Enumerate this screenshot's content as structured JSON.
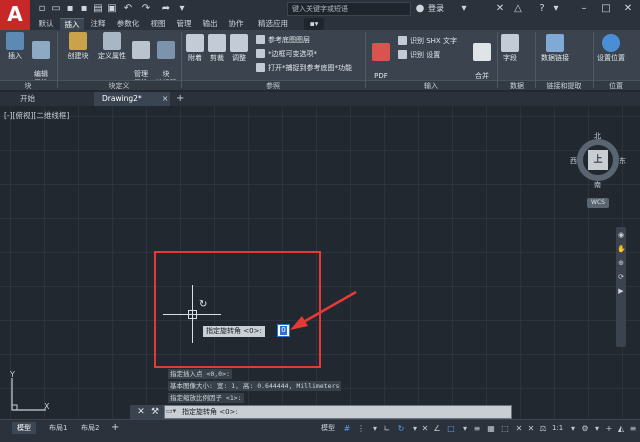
{
  "app": {
    "logo": "A"
  },
  "title_bar": {
    "search_placeholder": "键入关键字或短语",
    "signin_label": "登录"
  },
  "ribbon_tabs": [
    "默认",
    "插入",
    "注释",
    "参数化",
    "视图",
    "管理",
    "输出",
    "协作",
    "精选应用"
  ],
  "active_ribbon_tab": "插入",
  "ribbon": {
    "block": {
      "insert": "插入",
      "edit_attr": "编辑\n属性"
    },
    "block_def": {
      "create": "创建块",
      "define_attr": "定义属性",
      "manage_attr": "管理\n属性",
      "block_editor": "块\n编辑器"
    },
    "reference": {
      "attach": "附着",
      "clip": "剪裁",
      "adjust": "调整",
      "underlay_layers": "参考底图图层",
      "frame_variable": "*边框可变选项*",
      "snap_underlay": "打开*捕捉到参考底图*功能"
    },
    "import": {
      "pdf_import": "PDF\n输入",
      "recognize_shx": "识别 SHX 文字",
      "recognize_settings": "识别 设置",
      "combine_text": "合并\n文字"
    },
    "data": {
      "field": "字段",
      "data_link": "数据链接"
    },
    "location": {
      "set_location": "设置位置"
    },
    "groups": [
      "块",
      "块定义",
      "参照",
      "输入",
      "数据",
      "链接和提取",
      "位置"
    ]
  },
  "doc_tabs": [
    "开始",
    "Drawing2*"
  ],
  "active_doc_tab": "Drawing2*",
  "view_label": "[-][俯视][二维线框]",
  "viewcube": {
    "north": "北",
    "south": "南",
    "east": "东",
    "west": "西",
    "face": "上",
    "wcs": "WCS"
  },
  "dynamic_input": {
    "prompt": "指定旋转角 <0>:",
    "value": "0"
  },
  "command_history": [
    "指定插入点 <0,0>:",
    "基本图像大小: 宽: 1, 高: 0.644444, Millimeters",
    "指定缩放比例因子 <1>:"
  ],
  "command_line": {
    "text": "指定旋转角 <0>:"
  },
  "ucs": {
    "x": "X",
    "y": "Y"
  },
  "status_bar": {
    "layout_tabs": [
      "模型",
      "布局1",
      "布局2"
    ],
    "active_layout": "模型",
    "model_label": "模型",
    "scale": "1:1"
  },
  "colors": {
    "accent": "#e53935",
    "background": "#212830",
    "ribbon": "#3a434e"
  }
}
